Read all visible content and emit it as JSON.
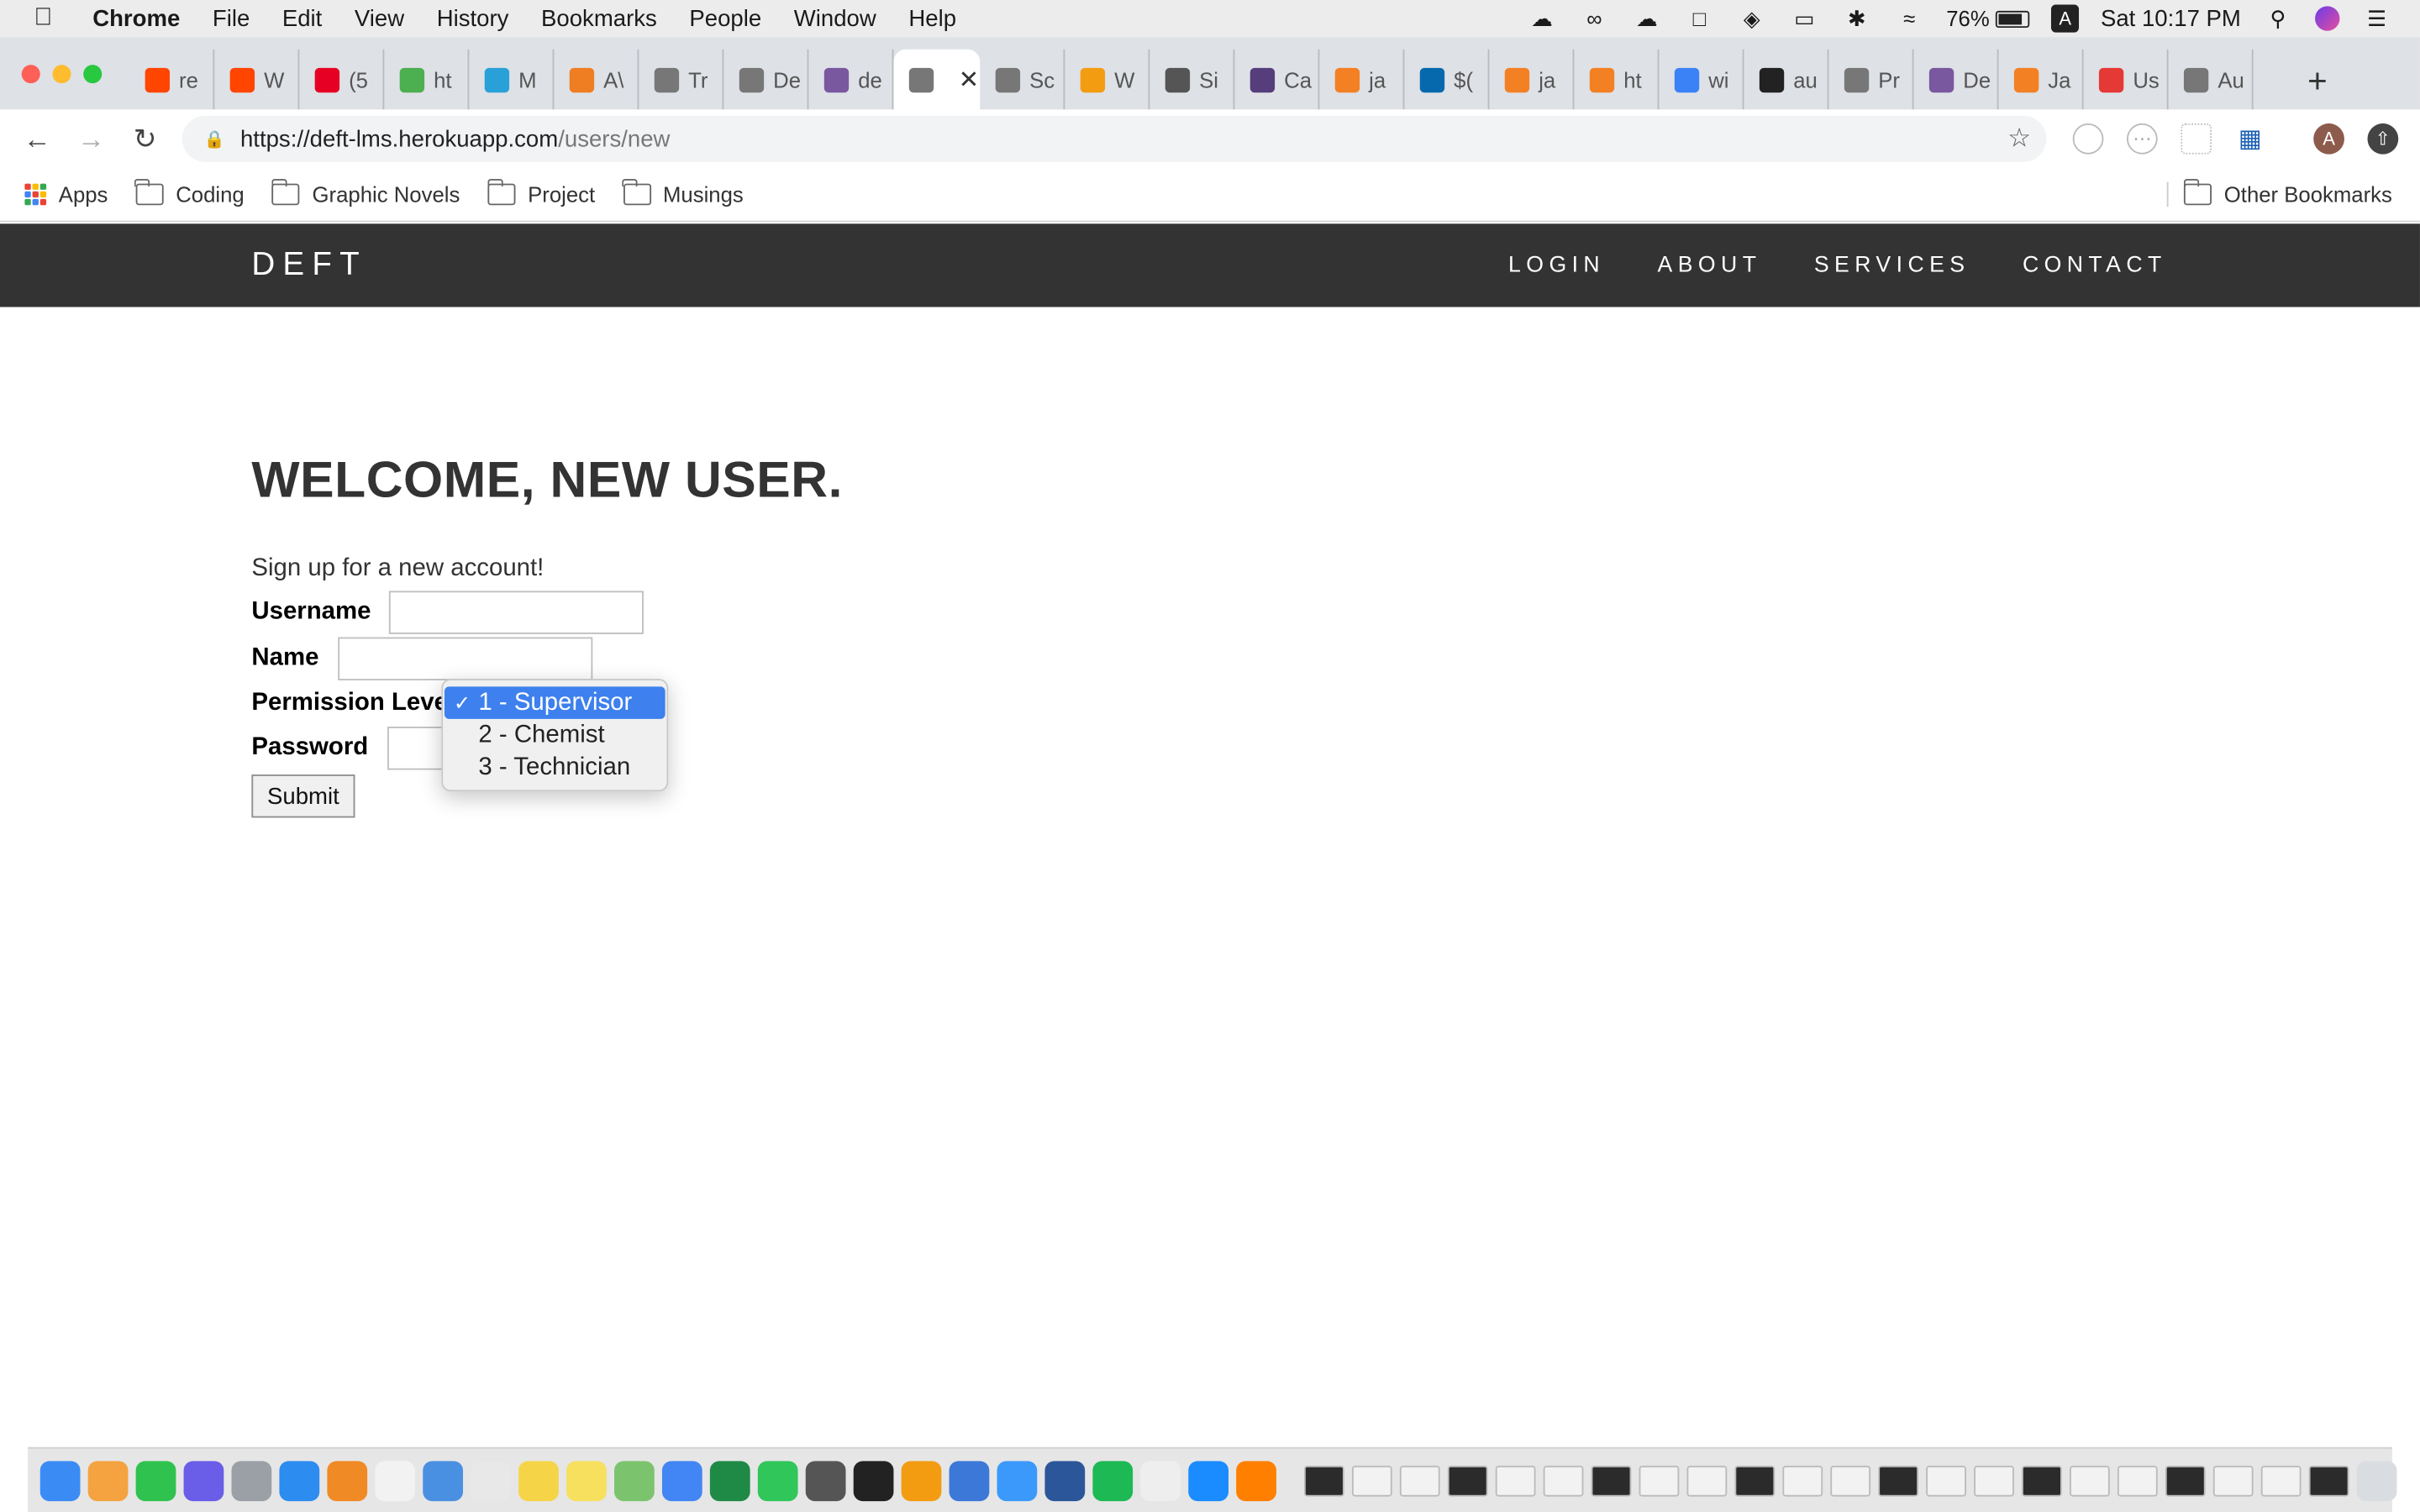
{
  "menubar": {
    "app": "Chrome",
    "items": [
      "File",
      "Edit",
      "View",
      "History",
      "Bookmarks",
      "People",
      "Window",
      "Help"
    ],
    "battery": "76%",
    "battery_level": 0.76,
    "clock": "Sat 10:17 PM"
  },
  "tabs": [
    {
      "label": "re",
      "icon": "reddit-icon",
      "color": "#ff4500"
    },
    {
      "label": "W",
      "icon": "reddit-icon",
      "color": "#ff4500"
    },
    {
      "label": "(5",
      "icon": "pinterest-icon",
      "color": "#e60023"
    },
    {
      "label": "ht",
      "icon": "w3schools-icon",
      "color": "#4caf50"
    },
    {
      "label": "M",
      "icon": "m-icon",
      "color": "#2aa0d8"
    },
    {
      "label": "A\\",
      "icon": "box-icon",
      "color": "#ef7d22"
    },
    {
      "label": "Tr",
      "icon": "page-icon",
      "color": "#777777"
    },
    {
      "label": "De",
      "icon": "page-icon",
      "color": "#777777"
    },
    {
      "label": "de",
      "icon": "heroku-icon",
      "color": "#79589f"
    },
    {
      "label": "",
      "icon": "page-icon",
      "color": "#777777",
      "active": true
    },
    {
      "label": "Sc",
      "icon": "page-icon",
      "color": "#777777"
    },
    {
      "label": "W",
      "icon": "gear-icon",
      "color": "#f39c12"
    },
    {
      "label": "Si",
      "icon": "avatar-icon",
      "color": "#555555"
    },
    {
      "label": "Ca",
      "icon": "bootstrap-icon",
      "color": "#563d7c"
    },
    {
      "label": "ja",
      "icon": "stackoverflow-icon",
      "color": "#f48024"
    },
    {
      "label": "$(",
      "icon": "jquery-icon",
      "color": "#0769ad"
    },
    {
      "label": "ja",
      "icon": "stackoverflow-icon",
      "color": "#f48024"
    },
    {
      "label": "ht",
      "icon": "stackoverflow-icon",
      "color": "#f48024"
    },
    {
      "label": "wi",
      "icon": "flag-icon",
      "color": "#3b82f6"
    },
    {
      "label": "au",
      "icon": "github-icon",
      "color": "#222222"
    },
    {
      "label": "Pr",
      "icon": "page-icon",
      "color": "#777777"
    },
    {
      "label": "De",
      "icon": "heroku-icon",
      "color": "#79589f"
    },
    {
      "label": "Ja",
      "icon": "stackoverflow-icon",
      "color": "#f48024"
    },
    {
      "label": "Us",
      "icon": "triangle-icon",
      "color": "#e53935"
    },
    {
      "label": "Au",
      "icon": "page-icon",
      "color": "#777777"
    }
  ],
  "omnibox": {
    "url_host": "https://deft-lms.herokuapp.com",
    "url_path": "/users/new"
  },
  "bookmarks": {
    "apps": "Apps",
    "folders": [
      "Coding",
      "Graphic Novels",
      "Project",
      "Musings"
    ],
    "other": "Other Bookmarks"
  },
  "profile_initial": "A",
  "site": {
    "brand": "DEFT",
    "nav": [
      "LOGIN",
      "ABOUT",
      "SERVICES",
      "CONTACT"
    ]
  },
  "page": {
    "title": "WELCOME, NEW USER.",
    "subtitle": "Sign up for a new account!",
    "labels": {
      "username": "Username",
      "name": "Name",
      "permission": "Permission Level",
      "password": "Password"
    },
    "submit": "Submit"
  },
  "dropdown": {
    "options": [
      "1 - Supervisor",
      "2 - Chemist",
      "3 - Technician"
    ],
    "selected_index": 0,
    "check": "✓"
  },
  "colors": {
    "navbar_bg": "#333333",
    "select_highlight": "#3d80ee"
  }
}
